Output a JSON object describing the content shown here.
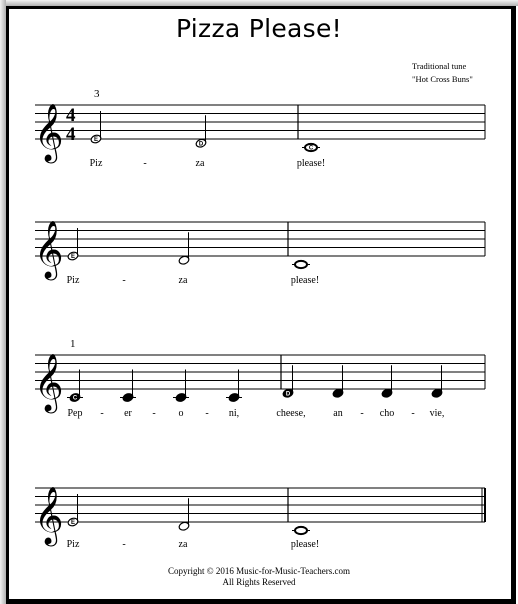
{
  "title": "Pizza Please!",
  "attribution": {
    "line1": "Traditional tune",
    "line2": "\"Hot Cross Buns\""
  },
  "time_signature": {
    "top": "4",
    "bottom": "4"
  },
  "clef": "treble-clef",
  "clef_glyph": "𝄞",
  "systems": [
    {
      "measure_number": "3",
      "show_time_signature": true,
      "final_barline": false,
      "notes": [
        {
          "pitch": "E",
          "duration": "half",
          "letter": "E"
        },
        {
          "pitch": "D",
          "duration": "half",
          "letter": "D"
        },
        {
          "pitch": "C",
          "duration": "whole",
          "letter": "C"
        }
      ],
      "lyrics": [
        "Piz",
        "-",
        "za",
        "please!"
      ]
    },
    {
      "measure_number": "",
      "show_time_signature": false,
      "final_barline": false,
      "notes": [
        {
          "pitch": "E",
          "duration": "half",
          "letter": "E"
        },
        {
          "pitch": "D",
          "duration": "half",
          "letter": ""
        },
        {
          "pitch": "C",
          "duration": "whole",
          "letter": ""
        }
      ],
      "lyrics": [
        "Piz",
        "-",
        "za",
        "please!"
      ]
    },
    {
      "measure_number": "1",
      "show_time_signature": false,
      "final_barline": false,
      "notes": [
        {
          "pitch": "C",
          "duration": "quarter",
          "letter": "C"
        },
        {
          "pitch": "C",
          "duration": "quarter",
          "letter": ""
        },
        {
          "pitch": "C",
          "duration": "quarter",
          "letter": ""
        },
        {
          "pitch": "C",
          "duration": "quarter",
          "letter": ""
        },
        {
          "pitch": "D",
          "duration": "quarter",
          "letter": "D"
        },
        {
          "pitch": "D",
          "duration": "quarter",
          "letter": ""
        },
        {
          "pitch": "D",
          "duration": "quarter",
          "letter": ""
        },
        {
          "pitch": "D",
          "duration": "quarter",
          "letter": ""
        }
      ],
      "lyrics": [
        "Pep",
        "-",
        "er",
        "-",
        "o",
        "-",
        "ni,",
        "cheese,",
        "an",
        "-",
        "cho",
        "-",
        "vie,"
      ]
    },
    {
      "measure_number": "",
      "show_time_signature": false,
      "final_barline": true,
      "notes": [
        {
          "pitch": "E",
          "duration": "half",
          "letter": "E"
        },
        {
          "pitch": "D",
          "duration": "half",
          "letter": ""
        },
        {
          "pitch": "C",
          "duration": "whole",
          "letter": ""
        }
      ],
      "lyrics": [
        "Piz",
        "-",
        "za",
        "please!"
      ]
    }
  ],
  "copyright": {
    "line1": "Copyright © 2016  Music-for-Music-Teachers.com",
    "line2": "All Rights Reserved"
  }
}
